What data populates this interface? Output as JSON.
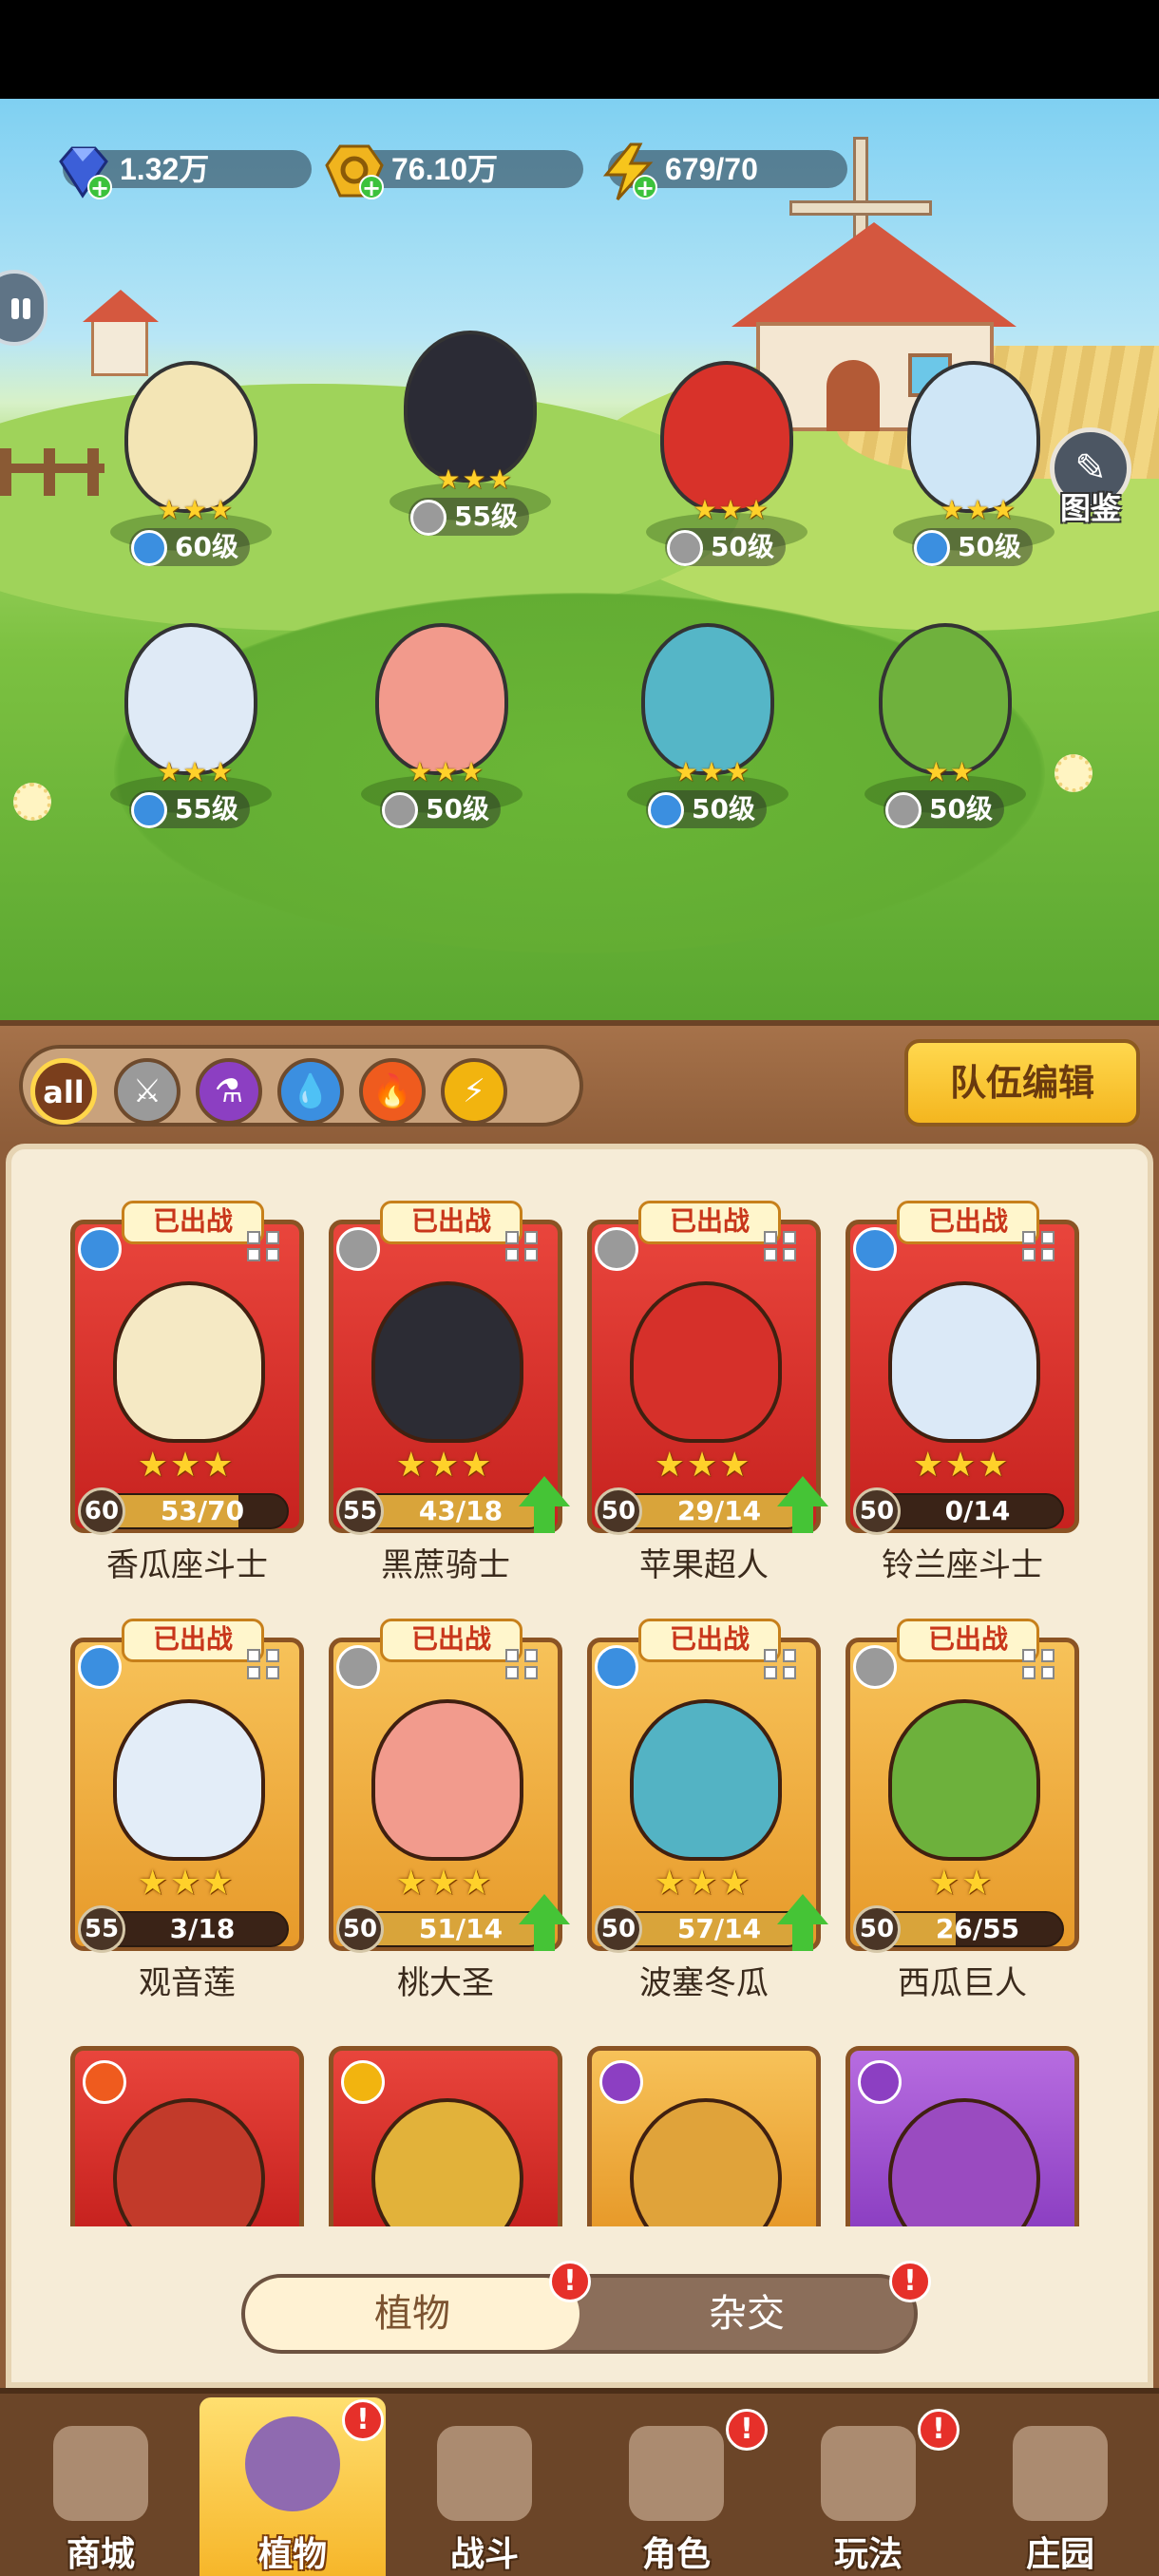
{
  "currencies": [
    {
      "name": "gem",
      "icon": "diamond-icon",
      "value": "1.32万",
      "color": "#3c5fd8"
    },
    {
      "name": "gold",
      "icon": "coin-icon",
      "value": "76.10万",
      "color": "#f0b41e"
    },
    {
      "name": "energy",
      "icon": "lightning-icon",
      "value": "679/70",
      "color": "#f7c51c"
    }
  ],
  "scene": {
    "tujian_label": "图鉴",
    "units": [
      {
        "stars": "★★★",
        "level": "60级",
        "element": "water",
        "color": "#f3e5b5"
      },
      {
        "stars": "★★★",
        "level": "55级",
        "element": "sword",
        "color": "#2b2b35"
      },
      {
        "stars": "★★★",
        "level": "50级",
        "element": "sword",
        "color": "#d8322a"
      },
      {
        "stars": "★★★",
        "level": "50级",
        "element": "water",
        "color": "#cfe6f6"
      },
      {
        "stars": "★★★",
        "level": "55级",
        "element": "water",
        "color": "#dfeaf6"
      },
      {
        "stars": "★★★",
        "level": "50级",
        "element": "sword",
        "color": "#f29a8c"
      },
      {
        "stars": "★★★",
        "level": "50级",
        "element": "water",
        "color": "#55b6c7"
      },
      {
        "stars": "★★",
        "level": "50级",
        "element": "sword",
        "color": "#6fb13d"
      }
    ]
  },
  "filters": {
    "all_label": "all",
    "types": [
      "sword",
      "poison",
      "water",
      "fire",
      "lightning"
    ],
    "team_edit_label": "队伍编辑"
  },
  "cards": [
    {
      "name": "香瓜座斗士",
      "tag": "已出战",
      "stars": "★★★",
      "level": "60",
      "progress": "53/70",
      "fill": 0.76,
      "rarity": "red",
      "element": "water",
      "upgradable": false,
      "portrait": "#f5e9c4"
    },
    {
      "name": "黑蔗骑士",
      "tag": "已出战",
      "stars": "★★★",
      "level": "55",
      "progress": "43/18",
      "fill": 1.0,
      "rarity": "red",
      "element": "sword",
      "upgradable": true,
      "portrait": "#2c2c34"
    },
    {
      "name": "苹果超人",
      "tag": "已出战",
      "stars": "★★★",
      "level": "50",
      "progress": "29/14",
      "fill": 1.0,
      "rarity": "red",
      "element": "sword",
      "upgradable": true,
      "portrait": "#d6302a"
    },
    {
      "name": "铃兰座斗士",
      "tag": "已出战",
      "stars": "★★★",
      "level": "50",
      "progress": "0/14",
      "fill": 0.0,
      "rarity": "red",
      "element": "water",
      "upgradable": false,
      "portrait": "#dbe9f7"
    },
    {
      "name": "观音莲",
      "tag": "已出战",
      "stars": "★★★",
      "level": "55",
      "progress": "3/18",
      "fill": 0.17,
      "rarity": "gold",
      "element": "water",
      "upgradable": false,
      "portrait": "#e3edf8"
    },
    {
      "name": "桃大圣",
      "tag": "已出战",
      "stars": "★★★",
      "level": "50",
      "progress": "51/14",
      "fill": 1.0,
      "rarity": "gold",
      "element": "sword",
      "upgradable": true,
      "portrait": "#f29b8d"
    },
    {
      "name": "波塞冬瓜",
      "tag": "已出战",
      "stars": "★★★",
      "level": "50",
      "progress": "57/14",
      "fill": 1.0,
      "rarity": "gold",
      "element": "water",
      "upgradable": true,
      "portrait": "#53b3c4"
    },
    {
      "name": "西瓜巨人",
      "tag": "已出战",
      "stars": "★★",
      "level": "50",
      "progress": "26/55",
      "fill": 0.47,
      "rarity": "gold",
      "element": "sword",
      "upgradable": false,
      "portrait": "#6db13c"
    }
  ],
  "partial_cards": [
    {
      "element": "fire",
      "rarity": "red",
      "portrait": "#c23a2a"
    },
    {
      "element": "lightning",
      "rarity": "red",
      "portrait": "#e2b23a"
    },
    {
      "element": "poison",
      "rarity": "gold",
      "portrait": "#e0a33a"
    },
    {
      "element": "poison",
      "rarity": "purple",
      "portrait": "#9a4bc0"
    }
  ],
  "toggle": {
    "left": "植物",
    "right": "杂交",
    "alert": "!"
  },
  "nav": [
    {
      "label": "商城",
      "icon": "shop-icon",
      "active": false,
      "alert": false
    },
    {
      "label": "植物",
      "icon": "plants-icon",
      "active": true,
      "alert": true
    },
    {
      "label": "战斗",
      "icon": "battle-icon",
      "active": false,
      "alert": false
    },
    {
      "label": "角色",
      "icon": "character-icon",
      "active": false,
      "alert": true
    },
    {
      "label": "玩法",
      "icon": "gameplay-icon",
      "active": false,
      "alert": true
    },
    {
      "label": "庄园",
      "icon": "manor-icon",
      "active": false,
      "alert": false
    }
  ],
  "element_colors": {
    "water": "#3b8fe0",
    "sword": "#9a9a9a",
    "poison": "#8c3fc2",
    "fire": "#ef5b1e",
    "lightning": "#f2b40f"
  }
}
